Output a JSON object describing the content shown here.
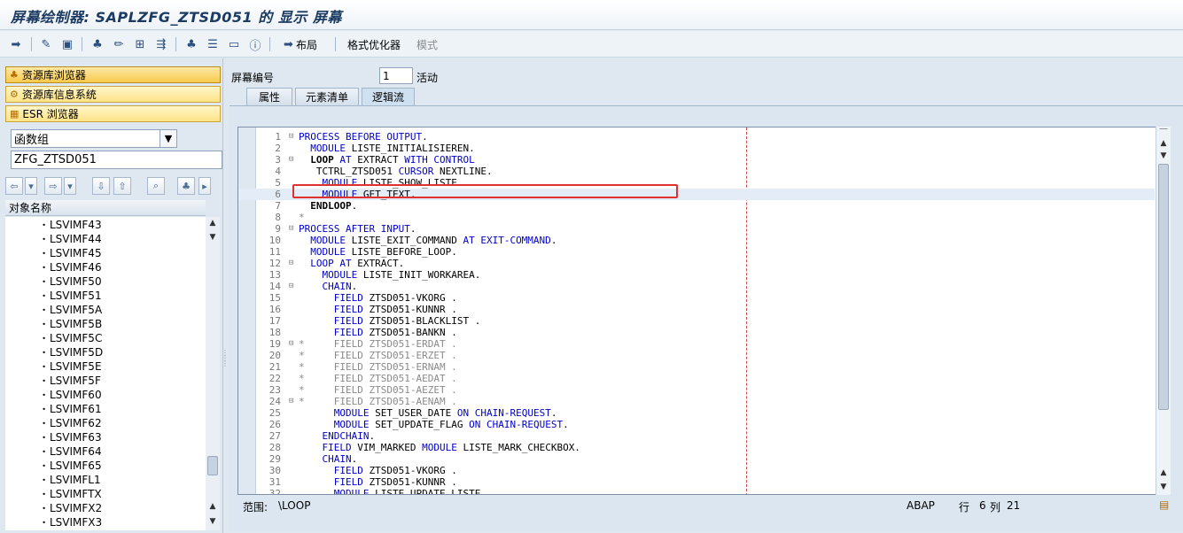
{
  "window": {
    "title": "屏幕绘制器: SAPLZFG_ZTSD051 的 显示 屏幕"
  },
  "toolbar": {
    "layout_label": "布局",
    "format_label": "格式优化器",
    "mode_label": "模式"
  },
  "left": {
    "nav_buttons": [
      "资源库浏览器",
      "资源库信息系统",
      "ESR 浏览器"
    ],
    "object_type": "函数组",
    "object_name": "ZFG_ZTSD051",
    "tree_header": "对象名称",
    "tree_items": [
      "LSVIMF43",
      "LSVIMF44",
      "LSVIMF45",
      "LSVIMF46",
      "LSVIMF50",
      "LSVIMF51",
      "LSVIMF5A",
      "LSVIMF5B",
      "LSVIMF5C",
      "LSVIMF5D",
      "LSVIMF5E",
      "LSVIMF5F",
      "LSVIMF60",
      "LSVIMF61",
      "LSVIMF62",
      "LSVIMF63",
      "LSVIMF64",
      "LSVIMF65",
      "LSVIMFL1",
      "LSVIMFTX",
      "LSVIMFX2",
      "LSVIMFX3"
    ]
  },
  "screen": {
    "label": "屏幕编号",
    "number": "1",
    "status": "活动",
    "tabs": [
      "属性",
      "元素清单",
      "逻辑流"
    ]
  },
  "code": [
    {
      "n": "1",
      "f": "⊟",
      "t": "PROCESS BEFORE OUTPUT."
    },
    {
      "n": "2",
      "f": "",
      "t": "  MODULE LISTE_INITIALISIEREN."
    },
    {
      "n": "3",
      "f": "⊟",
      "t": "  LOOP AT EXTRACT WITH CONTROL"
    },
    {
      "n": "4",
      "f": "",
      "t": "   TCTRL_ZTSD051 CURSOR NEXTLINE."
    },
    {
      "n": "5",
      "f": "",
      "t": "    MODULE LISTE_SHOW_LISTE."
    },
    {
      "n": "6",
      "f": "",
      "t": "    MODULE GET_TEXT."
    },
    {
      "n": "7",
      "f": "",
      "t": "  ENDLOOP."
    },
    {
      "n": "8",
      "f": "",
      "t": "*"
    },
    {
      "n": "9",
      "f": "⊟",
      "t": "PROCESS AFTER INPUT."
    },
    {
      "n": "10",
      "f": "",
      "t": "  MODULE LISTE_EXIT_COMMAND AT EXIT-COMMAND."
    },
    {
      "n": "11",
      "f": "",
      "t": "  MODULE LISTE_BEFORE_LOOP."
    },
    {
      "n": "12",
      "f": "⊟",
      "t": "  LOOP AT EXTRACT."
    },
    {
      "n": "13",
      "f": "",
      "t": "    MODULE LISTE_INIT_WORKAREA."
    },
    {
      "n": "14",
      "f": "⊟",
      "t": "    CHAIN."
    },
    {
      "n": "15",
      "f": "",
      "t": "      FIELD ZTSD051-VKORG ."
    },
    {
      "n": "16",
      "f": "",
      "t": "      FIELD ZTSD051-KUNNR ."
    },
    {
      "n": "17",
      "f": "",
      "t": "      FIELD ZTSD051-BLACKLIST ."
    },
    {
      "n": "18",
      "f": "",
      "t": "      FIELD ZTSD051-BANKN ."
    },
    {
      "n": "19",
      "f": "⊟",
      "t": "*     FIELD ZTSD051-ERDAT ."
    },
    {
      "n": "20",
      "f": "",
      "t": "*     FIELD ZTSD051-ERZET ."
    },
    {
      "n": "21",
      "f": "",
      "t": "*     FIELD ZTSD051-ERNAM ."
    },
    {
      "n": "22",
      "f": "",
      "t": "*     FIELD ZTSD051-AEDAT ."
    },
    {
      "n": "23",
      "f": "",
      "t": "*     FIELD ZTSD051-AEZET ."
    },
    {
      "n": "24",
      "f": "⊟",
      "t": "*     FIELD ZTSD051-AENAM ."
    },
    {
      "n": "25",
      "f": "",
      "t": "      MODULE SET_USER_DATE ON CHAIN-REQUEST."
    },
    {
      "n": "26",
      "f": "",
      "t": "      MODULE SET_UPDATE_FLAG ON CHAIN-REQUEST."
    },
    {
      "n": "27",
      "f": "",
      "t": "    ENDCHAIN."
    },
    {
      "n": "28",
      "f": "",
      "t": "    FIELD VIM_MARKED MODULE LISTE_MARK_CHECKBOX."
    },
    {
      "n": "29",
      "f": "",
      "t": "    CHAIN."
    },
    {
      "n": "30",
      "f": "",
      "t": "      FIELD ZTSD051-VKORG ."
    },
    {
      "n": "31",
      "f": "",
      "t": "      FIELD ZTSD051-KUNNR ."
    },
    {
      "n": "32",
      "f": "",
      "t": "      MODULE LISTE_UPDATE_LISTE."
    }
  ],
  "status": {
    "scope_label": "范围:",
    "scope_value": "\\LOOP",
    "language": "ABAP",
    "row_label": "行",
    "row_value": "6",
    "col_label": "列",
    "col_value": "21"
  }
}
